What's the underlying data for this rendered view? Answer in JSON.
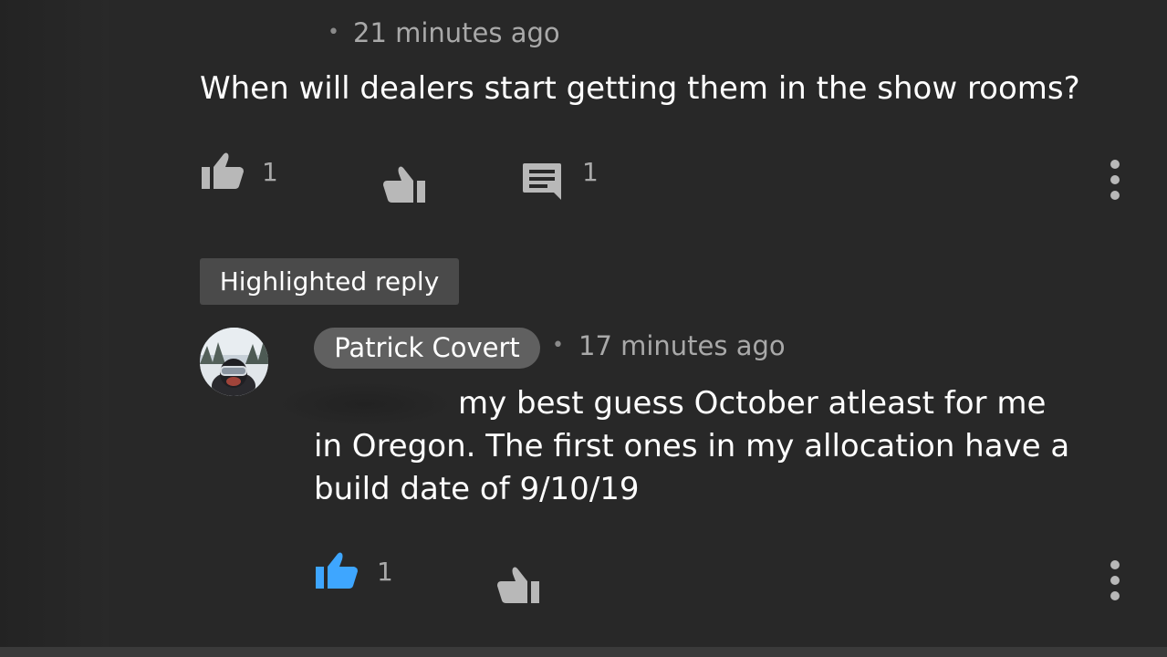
{
  "comment": {
    "timestamp": "21 minutes ago",
    "text": "When will dealers start getting them in the show rooms?",
    "likes": "1",
    "replies": "1"
  },
  "highlighted_label": "Highlighted reply",
  "reply": {
    "author": "Patrick Covert",
    "timestamp": "17 minutes ago",
    "lines": [
      "my best guess October atleast for me",
      "in Oregon. The first ones in my allocation have a",
      "build date of 9/10/19"
    ],
    "likes": "1"
  },
  "colors": {
    "background": "#282828",
    "liked_blue": "#3ea6ff",
    "icon_gray": "#b8b8b8",
    "meta_gray": "#a9a9a9"
  },
  "icons": [
    "thumb-up-icon",
    "thumb-down-icon",
    "comment-icon",
    "more-vert-icon",
    "thumb-up-filled-icon"
  ]
}
